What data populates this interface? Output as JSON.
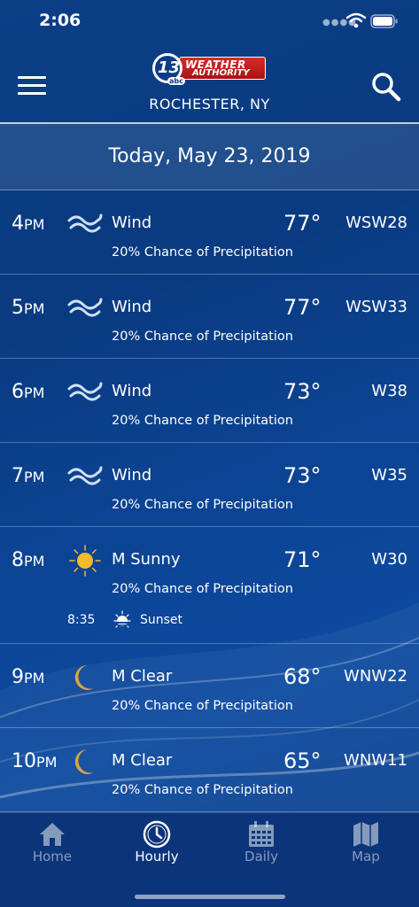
{
  "status_bar": {
    "time": "2:06"
  },
  "header": {
    "logo": {
      "number": "13",
      "network": "abc",
      "line1": "WEATHER",
      "line2": "AUTHORITY"
    },
    "location": "ROCHESTER, NY"
  },
  "date_bar": {
    "text": "Today, May 23, 2019"
  },
  "hours": [
    {
      "hour": "4",
      "ampm": "PM",
      "icon": "wind-icon",
      "condition": "Wind",
      "temp": "77°",
      "wind": "WSW28",
      "precip": "20% Chance of Precipitation"
    },
    {
      "hour": "5",
      "ampm": "PM",
      "icon": "wind-icon",
      "condition": "Wind",
      "temp": "77°",
      "wind": "WSW33",
      "precip": "20% Chance of Precipitation"
    },
    {
      "hour": "6",
      "ampm": "PM",
      "icon": "wind-icon",
      "condition": "Wind",
      "temp": "73°",
      "wind": "W38",
      "precip": "20% Chance of Precipitation"
    },
    {
      "hour": "7",
      "ampm": "PM",
      "icon": "wind-icon",
      "condition": "Wind",
      "temp": "73°",
      "wind": "W35",
      "precip": "20% Chance of Precipitation"
    },
    {
      "hour": "8",
      "ampm": "PM",
      "icon": "sun-icon",
      "condition": "M Sunny",
      "temp": "71°",
      "wind": "W30",
      "precip": "20% Chance of Precipitation",
      "event": {
        "time": "8:35",
        "icon": "sunset-icon",
        "label": "Sunset"
      }
    },
    {
      "hour": "9",
      "ampm": "PM",
      "icon": "moon-icon",
      "condition": "M Clear",
      "temp": "68°",
      "wind": "WNW22",
      "precip": "20% Chance of Precipitation"
    },
    {
      "hour": "10",
      "ampm": "PM",
      "icon": "moon-icon",
      "condition": "M Clear",
      "temp": "65°",
      "wind": "WNW11",
      "precip": "20% Chance of Precipitation"
    }
  ],
  "tabs": [
    {
      "label": "Home",
      "icon": "home-icon",
      "active": false
    },
    {
      "label": "Hourly",
      "icon": "clock-icon",
      "active": true
    },
    {
      "label": "Daily",
      "icon": "calendar-icon",
      "active": false
    },
    {
      "label": "Map",
      "icon": "map-icon",
      "active": false
    }
  ],
  "colors": {
    "background": "#0b3f86",
    "tab_bar": "#0b347a",
    "sun": "#f5b82e",
    "moon": "#d9a441"
  }
}
